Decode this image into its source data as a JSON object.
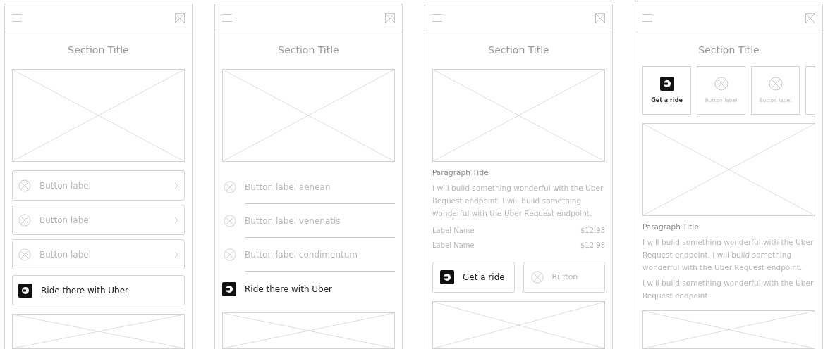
{
  "screens": [
    {
      "title": "Section Title",
      "blocks": [
        {
          "kind": "image"
        },
        {
          "kind": "bordered_list",
          "items": [
            "Button label",
            "Button label",
            "Button label"
          ]
        },
        {
          "kind": "uber_button",
          "label": "Ride there with Uber"
        },
        {
          "kind": "image"
        }
      ]
    },
    {
      "title": "Section Title",
      "blocks": [
        {
          "kind": "image"
        },
        {
          "kind": "plain_list",
          "items": [
            "Button label aenean",
            "Button label venenatis",
            "Button label condimentum"
          ]
        },
        {
          "kind": "uber_row",
          "label": "Ride there with Uber"
        },
        {
          "kind": "image"
        }
      ]
    },
    {
      "title": "Section Title",
      "blocks": [
        {
          "kind": "image"
        },
        {
          "kind": "paragraph",
          "title": "Paragraph Title",
          "texts": [
            "I will build something wonderful with the Uber Request endpoint. I will build something wonderful with the Uber Request endpoint."
          ]
        },
        {
          "kind": "prices",
          "rows": [
            {
              "label": "Label Name",
              "value": "$12.98"
            },
            {
              "label": "Label Name",
              "value": "$12.98"
            }
          ]
        },
        {
          "kind": "button_pair",
          "primary": "Get a ride",
          "secondary": "Button"
        },
        {
          "kind": "image"
        }
      ]
    },
    {
      "title": "Section Title",
      "blocks": [
        {
          "kind": "tiles",
          "primary": "Get a ride",
          "items": [
            "Button label",
            "Button label"
          ]
        },
        {
          "kind": "image"
        },
        {
          "kind": "paragraph",
          "title": "Paragraph Title",
          "texts": [
            "I will build something wonderful with the Uber Request endpoint. I will build something wonderful with the Uber Request endpoint.",
            "I will build something wonderful with the Uber Request endpoint."
          ]
        },
        {
          "kind": "image"
        }
      ]
    }
  ]
}
